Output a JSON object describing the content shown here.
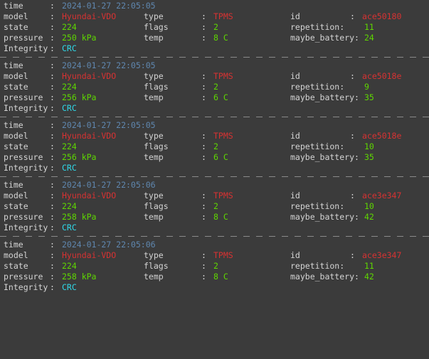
{
  "terminal": {
    "background_color": "#3b3b3b",
    "label_color": "#d4d4d4",
    "colors": {
      "time": "#5f87af",
      "model_id": "#d83232",
      "numeric": "#5fd700",
      "integrity": "#2fd8e8"
    },
    "colon": ":",
    "labels": {
      "time": "time",
      "model": "model",
      "state": "state",
      "pressure": "pressure",
      "integrity": "Integrity",
      "type": "type",
      "flags": "flags",
      "temp": "temp",
      "id": "id",
      "repetition": "repetition:",
      "maybe_battery": "maybe_battery:"
    }
  },
  "records": [
    {
      "time": "2024-01-27 22:05:05",
      "model": "Hyundai-VDO",
      "type": "TPMS",
      "id": "ace50180",
      "state": "224",
      "flags": "2",
      "repetition": "11",
      "pressure": "250 kPa",
      "temp": "8 C",
      "maybe_battery": "24",
      "integrity": "CRC"
    },
    {
      "time": "2024-01-27 22:05:05",
      "model": "Hyundai-VDO",
      "type": "TPMS",
      "id": "ace5018e",
      "state": "224",
      "flags": "2",
      "repetition": "9",
      "pressure": "256 kPa",
      "temp": "6 C",
      "maybe_battery": "35",
      "integrity": "CRC"
    },
    {
      "time": "2024-01-27 22:05:05",
      "model": "Hyundai-VDO",
      "type": "TPMS",
      "id": "ace5018e",
      "state": "224",
      "flags": "2",
      "repetition": "10",
      "pressure": "256 kPa",
      "temp": "6 C",
      "maybe_battery": "35",
      "integrity": "CRC"
    },
    {
      "time": "2024-01-27 22:05:06",
      "model": "Hyundai-VDO",
      "type": "TPMS",
      "id": "ace3e347",
      "state": "224",
      "flags": "2",
      "repetition": "10",
      "pressure": "258 kPa",
      "temp": "8 C",
      "maybe_battery": "42",
      "integrity": "CRC"
    },
    {
      "time": "2024-01-27 22:05:06",
      "model": "Hyundai-VDO",
      "type": "TPMS",
      "id": "ace3e347",
      "state": "224",
      "flags": "2",
      "repetition": "11",
      "pressure": "258 kPa",
      "temp": "8 C",
      "maybe_battery": "42",
      "integrity": "CRC"
    }
  ]
}
